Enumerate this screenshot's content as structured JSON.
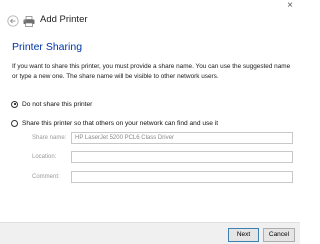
{
  "window": {
    "title": "Add Printer",
    "close_glyph": "×"
  },
  "page": {
    "heading": "Printer Sharing",
    "description": "If you want to share this printer, you must provide a share name. You can use the suggested name or type a new one. The share name will be visible to other network users."
  },
  "options": {
    "do_not_share": {
      "label": "Do not share this printer",
      "checked": true
    },
    "share": {
      "label": "Share this printer so that others on your network can find and use it",
      "checked": false
    }
  },
  "fields": {
    "share_name": {
      "label": "Share name:",
      "value": "HP LaserJet 5200 PCL6 Class Driver"
    },
    "location": {
      "label": "Location:",
      "value": ""
    },
    "comment": {
      "label": "Comment:",
      "value": ""
    }
  },
  "footer": {
    "next_label": "Next",
    "cancel_label": "Cancel"
  },
  "icons": {
    "back": "back-arrow-icon",
    "printer": "printer-icon",
    "close": "close-icon"
  }
}
